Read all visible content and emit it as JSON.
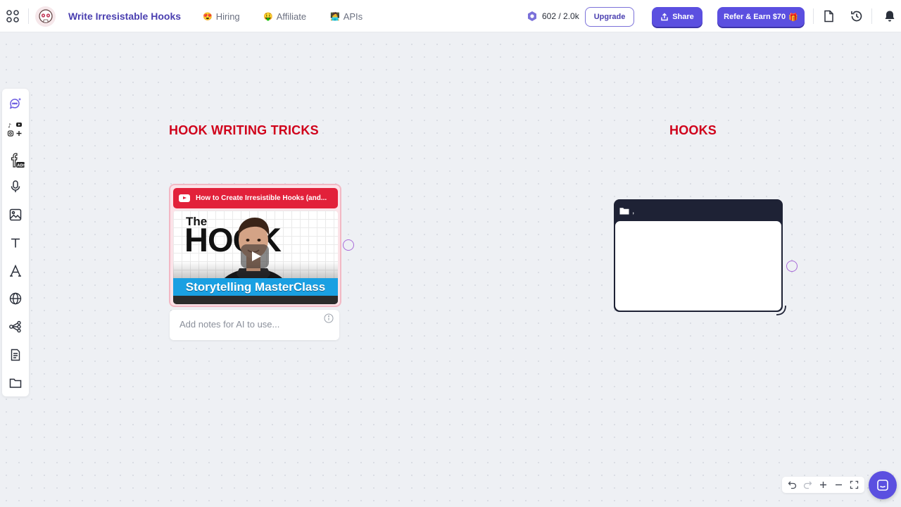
{
  "app": {
    "title": "Write Irresistable Hooks",
    "nav": [
      {
        "label": "Hiring",
        "emoji": "😍"
      },
      {
        "label": "Affiliate",
        "emoji": "🤑"
      },
      {
        "label": "APIs",
        "emoji": "🧑‍💻"
      }
    ],
    "credits": "602 / 2.0k",
    "upgrade_label": "Upgrade",
    "share_label": "Share",
    "refer_label": "Refer & Earn $70",
    "refer_emoji": "🎁"
  },
  "canvas": {
    "heading_left": "HOOK WRITING TRICKS",
    "heading_right": "HOOKS",
    "video": {
      "title": "How to Create Irresistible Hooks (and...",
      "thumb_word_small": "The",
      "thumb_word_big": "HOOK",
      "thumb_banner": "Storytelling MasterClass"
    },
    "notes_placeholder": "Add notes for AI to use...",
    "folder_label": ","
  },
  "colors": {
    "accent": "#5b4fe0",
    "heading_red": "#d0021b",
    "folder_dark": "#1e2235",
    "handle_purple": "#a86ad8"
  },
  "icons": {
    "left_tools": [
      "ai-chat-icon",
      "social-icons",
      "facebook-ads-icon",
      "microphone-icon",
      "image-icon",
      "text-icon",
      "font-icon",
      "globe-icon",
      "mindmap-icon",
      "document-icon",
      "folder-icon"
    ],
    "top_right": [
      "file-icon",
      "history-icon",
      "bell-icon"
    ],
    "zoom": [
      "undo-icon",
      "redo-icon",
      "zoom-in-icon",
      "zoom-out-icon",
      "fullscreen-icon"
    ]
  }
}
